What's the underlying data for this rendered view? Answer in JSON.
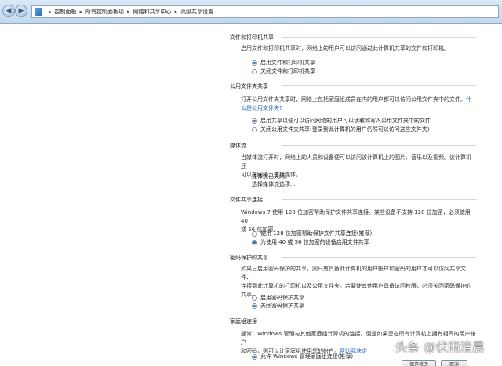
{
  "address_bar": {
    "crumbs": [
      "控制面板",
      "所有控制面板项",
      "网络和共享中心",
      "高级共享设置"
    ]
  },
  "sections": {
    "file_printer": {
      "title": "文件和打印机共享",
      "desc": "启用文件和打印机共享时，网络上的用户可以访问通过此计算机共享的文件和打印机。",
      "options": [
        "启用文件和打印机共享",
        "关闭文件和打印机共享"
      ],
      "selected": 0
    },
    "public_folder": {
      "title": "公用文件夹共享",
      "desc": "打开公用文件夹共享时，网络上包括家庭组成员在内的用户都可以访问公用文件夹中的文件。",
      "link": "什么是公用文件夹?",
      "options": [
        "启用共享以便可以访问网络的用户可以读取和写入公用文件夹中的文件",
        "关闭公用文件夹共享(登录到此计算机的用户仍然可以访问这些文件夹)"
      ],
      "selected": 0
    },
    "media": {
      "title": "媒体流",
      "desc_line1": "当媒体流打开时，网络上的人员和设备便可以访问该计算机上的图片、音乐以及视频。该计算机还",
      "desc_line2": "可以在网络上查找媒体。",
      "status": "媒体流已关闭。",
      "link": "选择媒体流选项..."
    },
    "file_sharing_conn": {
      "title": "文件共享连接",
      "desc_line1": "Windows 7 使用 128 位加密帮助保护文件共享连接。某些设备不支持 128 位加密，必须使用 40",
      "desc_line2": "或 56 位加密。",
      "options": [
        "使用 128 位加密帮助保护文件共享连接(推荐)",
        "为使用 40 或 56 位加密的设备启用文件共享"
      ],
      "selected": 1
    },
    "password": {
      "title": "密码保护的共享",
      "desc_line1": "如果已启用密码保护的共享，则只有具备此计算机的用户帐户和密码的用户才可以访问共享文件、",
      "desc_line2": "连接到此计算机的打印机以及公用文件夹。若要使其他用户具备访问权限，必须关闭密码保护的共享。",
      "options": [
        "启用密码保护共享",
        "关闭密码保护共享"
      ],
      "selected": 1
    },
    "homegroup": {
      "title": "家庭组连接",
      "desc_line1": "通常，Windows 管理与其他家庭组计算机的连接。但是如果您在所有计算机上拥有相同的用户帐户",
      "desc_line2": "和密码，则可以让家庭组使用您的帐户。",
      "link": "帮助我决定",
      "option_visible": "允许 Windows 管理家庭组连接(推荐)"
    }
  },
  "buttons": {
    "save": "保存修改",
    "cancel": "取消"
  },
  "watermark": "头条 @伏雨清晨",
  "colors": {
    "accent_link": "#2566c4",
    "addrbar": "#c3d8ee"
  }
}
